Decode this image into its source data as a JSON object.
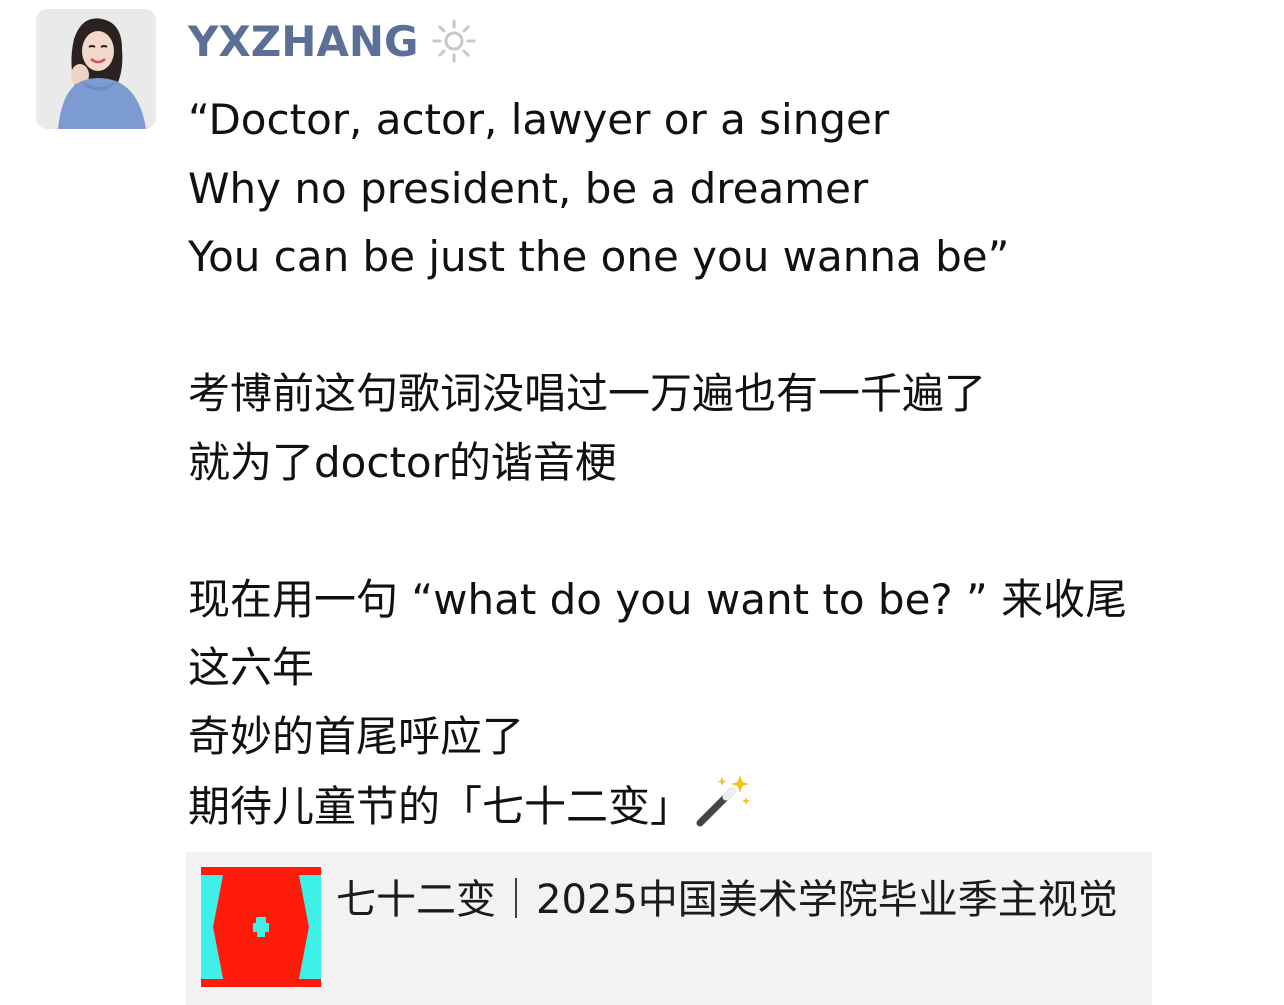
{
  "post": {
    "username": "YXZHANG",
    "badge_icon": "sun-icon",
    "lines": [
      "“Doctor, actor, lawyer or a singer",
      "Why no president, be a dreamer",
      "You can be just the one you wanna be”",
      "考博前这句歌词没唱过一万遍也有一千遍了",
      "就为了doctor的谐音梗",
      "现在用一句 “what do you want to be? ” 来收尾",
      "这六年",
      "奇妙的首尾呼应了",
      "期待儿童节的「七十二变」"
    ],
    "trailing_emoji_icon": "magic-wand-icon"
  },
  "link_card": {
    "title": "七十二变｜2025中国美术学院毕业季主视觉",
    "thumbnail_colors": {
      "red": "#ff1a0a",
      "cyan": "#3ff0e8"
    }
  },
  "colors": {
    "username": "#5b6f97",
    "text": "#111111",
    "card_background": "#f3f3f3"
  }
}
